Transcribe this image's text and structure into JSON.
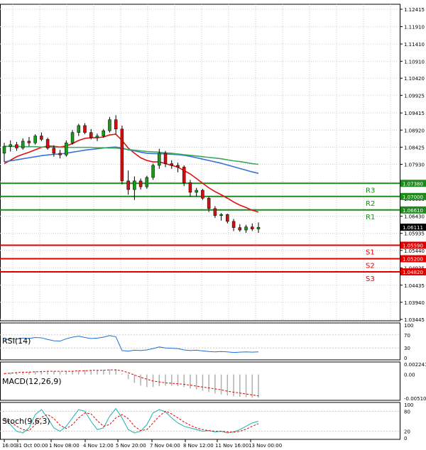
{
  "price_axis": [
    "1.12415",
    "1.11910",
    "1.11410",
    "1.10910",
    "1.10420",
    "1.09925",
    "1.09415",
    "1.08920",
    "1.08425",
    "1.07930",
    "1.07430",
    "1.06935",
    "1.06430",
    "1.05935",
    "1.05440",
    "1.04935",
    "1.04435",
    "1.03940",
    "1.03445"
  ],
  "current_price": "1.06111",
  "levels": [
    {
      "name": "R3",
      "price": "1.07380",
      "value": 1.0738,
      "color": "#1e8a1e"
    },
    {
      "name": "R2",
      "price": "1.07000",
      "value": 1.07,
      "color": "#1e8a1e"
    },
    {
      "name": "R1",
      "price": "1.06610",
      "value": 1.0661,
      "color": "#1e8a1e"
    },
    {
      "name": "S1",
      "price": "1.05590",
      "value": 1.0559,
      "color": "#e00000"
    },
    {
      "name": "S2",
      "price": "1.05200",
      "value": 1.052,
      "color": "#e00000"
    },
    {
      "name": "S3",
      "price": "1.04820",
      "value": 1.0482,
      "color": "#e00000"
    }
  ],
  "rsi": {
    "label": "RSI(14)",
    "axis": [
      "100",
      "70",
      "30",
      "0"
    ],
    "color": "#1e6fd9"
  },
  "macd": {
    "label": "MACD(12,26,9)",
    "axis": [
      "0.002241",
      "0.00",
      "-0.005106"
    ],
    "hist_color": "#b0b0b0",
    "signal_color": "#e00000"
  },
  "stoch": {
    "label": "Stoch(9,6,3)",
    "axis": [
      "100",
      "80",
      "20",
      "0"
    ],
    "main_color": "#20b0b0",
    "signal_color": "#e00000"
  },
  "time_axis": [
    "16:00",
    "31 Oct 00:00",
    "1 Nov 08:00",
    "4 Nov 12:00",
    "5 Nov 20:00",
    "7 Nov 04:00",
    "8 Nov 12:00",
    "11 Nov 16:00",
    "13 Nov 00:00"
  ],
  "colors": {
    "bull": "#1a9a1a",
    "bear": "#d01010",
    "ma_fast": "#e01010",
    "ma_mid": "#3a6fd8",
    "ma_slow": "#3aa860"
  },
  "chart_data": {
    "type": "candlestick",
    "title": "",
    "ylim": [
      1.03445,
      1.12415
    ],
    "x": [
      "16:00",
      "31 Oct 00:00",
      "1 Nov 08:00",
      "4 Nov 12:00",
      "5 Nov 20:00",
      "7 Nov 04:00",
      "8 Nov 12:00",
      "11 Nov 16:00",
      "13 Nov 00:00"
    ],
    "candles": [
      {
        "o": 1.0825,
        "h": 1.0855,
        "l": 1.08,
        "c": 1.0845
      },
      {
        "o": 1.0845,
        "h": 1.0862,
        "l": 1.083,
        "c": 1.085
      },
      {
        "o": 1.085,
        "h": 1.0858,
        "l": 1.0832,
        "c": 1.084
      },
      {
        "o": 1.084,
        "h": 1.0868,
        "l": 1.0835,
        "c": 1.086
      },
      {
        "o": 1.086,
        "h": 1.0872,
        "l": 1.0845,
        "c": 1.0855
      },
      {
        "o": 1.0855,
        "h": 1.088,
        "l": 1.085,
        "c": 1.0875
      },
      {
        "o": 1.0875,
        "h": 1.0885,
        "l": 1.086,
        "c": 1.0865
      },
      {
        "o": 1.0865,
        "h": 1.087,
        "l": 1.0835,
        "c": 1.084
      },
      {
        "o": 1.084,
        "h": 1.0848,
        "l": 1.0815,
        "c": 1.0825
      },
      {
        "o": 1.0825,
        "h": 1.0835,
        "l": 1.081,
        "c": 1.082
      },
      {
        "o": 1.082,
        "h": 1.0862,
        "l": 1.0815,
        "c": 1.0855
      },
      {
        "o": 1.0855,
        "h": 1.0892,
        "l": 1.085,
        "c": 1.0885
      },
      {
        "o": 1.0885,
        "h": 1.091,
        "l": 1.0875,
        "c": 1.0905
      },
      {
        "o": 1.0905,
        "h": 1.0912,
        "l": 1.088,
        "c": 1.0885
      },
      {
        "o": 1.0885,
        "h": 1.0895,
        "l": 1.0865,
        "c": 1.087
      },
      {
        "o": 1.087,
        "h": 1.0882,
        "l": 1.086,
        "c": 1.0875
      },
      {
        "o": 1.0875,
        "h": 1.0895,
        "l": 1.087,
        "c": 1.089
      },
      {
        "o": 1.089,
        "h": 1.093,
        "l": 1.0885,
        "c": 1.0922
      },
      {
        "o": 1.0922,
        "h": 1.0935,
        "l": 1.088,
        "c": 1.0895
      },
      {
        "o": 1.0895,
        "h": 1.0905,
        "l": 1.0735,
        "c": 1.0745
      },
      {
        "o": 1.0745,
        "h": 1.0775,
        "l": 1.0705,
        "c": 1.072
      },
      {
        "o": 1.072,
        "h": 1.0758,
        "l": 1.069,
        "c": 1.0745
      },
      {
        "o": 1.0745,
        "h": 1.0752,
        "l": 1.072,
        "c": 1.0728
      },
      {
        "o": 1.0728,
        "h": 1.076,
        "l": 1.0722,
        "c": 1.0755
      },
      {
        "o": 1.0755,
        "h": 1.0795,
        "l": 1.0748,
        "c": 1.079
      },
      {
        "o": 1.079,
        "h": 1.0838,
        "l": 1.078,
        "c": 1.0825
      },
      {
        "o": 1.0825,
        "h": 1.0832,
        "l": 1.0785,
        "c": 1.0795
      },
      {
        "o": 1.0795,
        "h": 1.0805,
        "l": 1.078,
        "c": 1.079
      },
      {
        "o": 1.079,
        "h": 1.0798,
        "l": 1.077,
        "c": 1.0785
      },
      {
        "o": 1.0785,
        "h": 1.079,
        "l": 1.073,
        "c": 1.074
      },
      {
        "o": 1.074,
        "h": 1.0748,
        "l": 1.07,
        "c": 1.0712
      },
      {
        "o": 1.0712,
        "h": 1.0725,
        "l": 1.07,
        "c": 1.0718
      },
      {
        "o": 1.0718,
        "h": 1.0722,
        "l": 1.069,
        "c": 1.0695
      },
      {
        "o": 1.0695,
        "h": 1.07,
        "l": 1.0655,
        "c": 1.0665
      },
      {
        "o": 1.0665,
        "h": 1.0672,
        "l": 1.0638,
        "c": 1.0645
      },
      {
        "o": 1.0645,
        "h": 1.0652,
        "l": 1.063,
        "c": 1.0648
      },
      {
        "o": 1.0648,
        "h": 1.065,
        "l": 1.0622,
        "c": 1.0628
      },
      {
        "o": 1.0628,
        "h": 1.0635,
        "l": 1.06,
        "c": 1.061
      },
      {
        "o": 1.061,
        "h": 1.062,
        "l": 1.0598,
        "c": 1.0603
      },
      {
        "o": 1.0603,
        "h": 1.0618,
        "l": 1.0595,
        "c": 1.0612
      },
      {
        "o": 1.0612,
        "h": 1.0622,
        "l": 1.06,
        "c": 1.0606
      },
      {
        "o": 1.0606,
        "h": 1.0625,
        "l": 1.0595,
        "c": 1.0611
      }
    ],
    "series": [
      {
        "values": [
          1.0795,
          1.0805,
          1.0815,
          1.0822,
          1.0828,
          1.0835,
          1.0842,
          1.0846,
          1.0845,
          1.0843,
          1.0846,
          1.0853,
          1.0862,
          1.0868,
          1.087,
          1.087,
          1.0872,
          1.0878,
          1.088,
          1.0862,
          1.084,
          1.0825,
          1.0812,
          1.0804,
          1.08,
          1.08,
          1.0795,
          1.079,
          1.0785,
          1.0775,
          1.0765,
          1.0752,
          1.0738,
          1.0725,
          1.0714,
          1.0705,
          1.0695,
          1.0684,
          1.0675,
          1.0668,
          1.066,
          1.0655
        ]
      },
      {
        "values": [
          1.08,
          1.0803,
          1.0806,
          1.0809,
          1.0812,
          1.0815,
          1.0818,
          1.082,
          1.0822,
          1.0823,
          1.0825,
          1.0828,
          1.0831,
          1.0834,
          1.0836,
          1.0838,
          1.084,
          1.0842,
          1.0843,
          1.084,
          1.0835,
          1.0832,
          1.0828,
          1.0825,
          1.0824,
          1.0824,
          1.0823,
          1.0822,
          1.0821,
          1.0819,
          1.0816,
          1.0812,
          1.0808,
          1.0804,
          1.08,
          1.0796,
          1.0791,
          1.0786,
          1.0781,
          1.0776,
          1.0771,
          1.0767
        ]
      },
      {
        "values": [
          1.0845,
          1.0845,
          1.0845,
          1.0844,
          1.0844,
          1.0844,
          1.0843,
          1.0843,
          1.0843,
          1.0842,
          1.0842,
          1.0842,
          1.0842,
          1.0842,
          1.0842,
          1.0841,
          1.0841,
          1.084,
          1.084,
          1.0838,
          1.0836,
          1.0834,
          1.0832,
          1.083,
          1.0829,
          1.0828,
          1.0826,
          1.0825,
          1.0823,
          1.0821,
          1.0819,
          1.0817,
          1.0815,
          1.0813,
          1.0811,
          1.0809,
          1.0806,
          1.0803,
          1.0801,
          1.0798,
          1.0795,
          1.0793
        ]
      }
    ],
    "rsi": [
      55,
      58,
      57,
      60,
      59,
      62,
      61,
      56,
      52,
      51,
      58,
      63,
      66,
      62,
      59,
      60,
      63,
      68,
      64,
      22,
      20,
      23,
      22,
      24,
      28,
      33,
      30,
      29,
      28,
      24,
      22,
      23,
      21,
      19,
      18,
      19,
      18,
      16,
      17,
      18,
      17,
      18
    ],
    "macd_hist": [
      0.0003,
      0.0004,
      0.0005,
      0.0006,
      0.0006,
      0.0007,
      0.0008,
      0.0008,
      0.0007,
      0.0006,
      0.0007,
      0.0008,
      0.0009,
      0.001,
      0.0009,
      0.0009,
      0.001,
      0.0011,
      0.0012,
      0.0002,
      -0.001,
      -0.0018,
      -0.0024,
      -0.0027,
      -0.0027,
      -0.0025,
      -0.0024,
      -0.0024,
      -0.0025,
      -0.0027,
      -0.003,
      -0.0032,
      -0.0035,
      -0.0038,
      -0.0041,
      -0.0043,
      -0.0045,
      -0.0047,
      -0.0048,
      -0.0049,
      -0.005,
      -0.005
    ],
    "macd_signal": [
      0.0002,
      0.0003,
      0.0004,
      0.0005,
      0.0005,
      0.0006,
      0.0006,
      0.0007,
      0.0007,
      0.0007,
      0.0007,
      0.0007,
      0.0008,
      0.0008,
      0.0009,
      0.0009,
      0.0009,
      0.001,
      0.001,
      0.0008,
      0.0004,
      -0.0001,
      -0.0006,
      -0.001,
      -0.0014,
      -0.0016,
      -0.0018,
      -0.0019,
      -0.002,
      -0.0021,
      -0.0023,
      -0.0025,
      -0.0027,
      -0.0029,
      -0.0031,
      -0.0033,
      -0.0036,
      -0.0038,
      -0.004,
      -0.0042,
      -0.0044,
      -0.0046
    ],
    "stoch_k": [
      60,
      40,
      20,
      15,
      30,
      70,
      85,
      60,
      30,
      20,
      35,
      60,
      85,
      80,
      50,
      25,
      30,
      65,
      88,
      60,
      25,
      15,
      20,
      40,
      75,
      85,
      78,
      60,
      45,
      35,
      30,
      25,
      20,
      22,
      18,
      20,
      15,
      18,
      25,
      35,
      45,
      50
    ],
    "stoch_d": [
      55,
      48,
      35,
      25,
      22,
      40,
      62,
      70,
      58,
      38,
      28,
      40,
      60,
      75,
      72,
      52,
      35,
      40,
      60,
      70,
      58,
      35,
      22,
      25,
      45,
      65,
      80,
      72,
      60,
      48,
      38,
      30,
      25,
      22,
      20,
      20,
      18,
      17,
      20,
      26,
      35,
      43
    ]
  }
}
